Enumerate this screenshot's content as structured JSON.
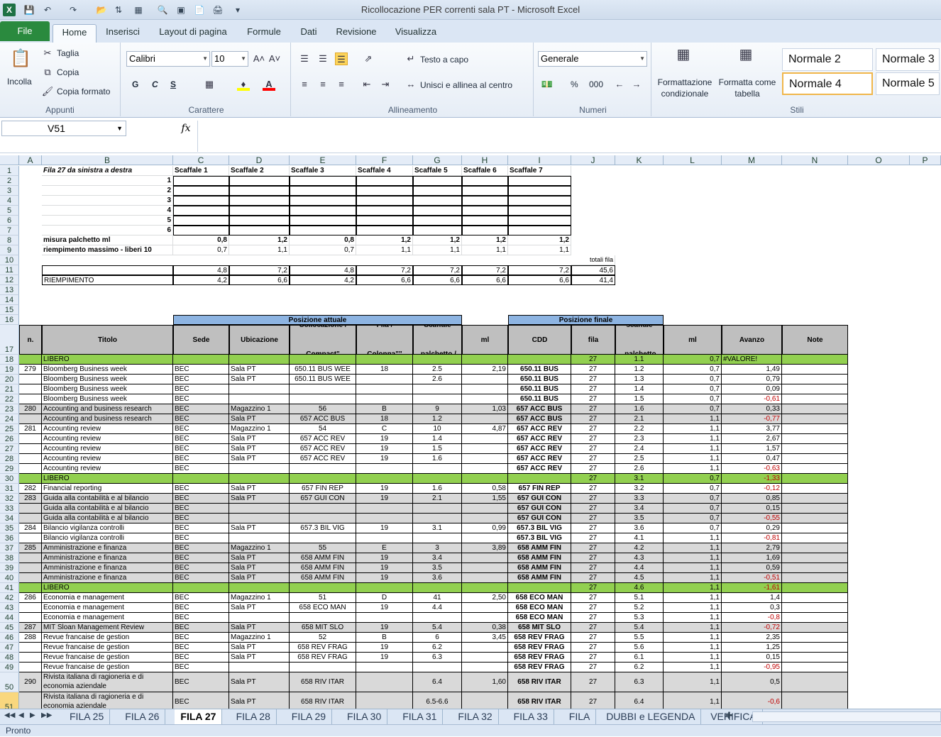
{
  "app": {
    "title": "Ricollocazione PER correnti sala PT  -  Microsoft Excel"
  },
  "ribbon": {
    "tabs": [
      "File",
      "Home",
      "Inserisci",
      "Layout di pagina",
      "Formule",
      "Dati",
      "Revisione",
      "Visualizza"
    ],
    "clipboard": {
      "paste": "Incolla",
      "cut": "Taglia",
      "copy": "Copia",
      "format_painter": "Copia formato",
      "label": "Appunti"
    },
    "font": {
      "name": "Calibri",
      "size": "10",
      "bold": "G",
      "italic": "C",
      "underline": "S",
      "label": "Carattere"
    },
    "alignment": {
      "wrap": "Testo a capo",
      "merge": "Unisci e allinea al centro",
      "label": "Allineamento"
    },
    "number": {
      "format": "Generale",
      "percent": "%",
      "thousands": "000",
      "label": "Numeri"
    },
    "styles": {
      "cond_format": "Formattazione condizionale",
      "as_table": "Formatta come tabella",
      "items": [
        "Normale 2",
        "Normale 3",
        "Normale 4",
        "Normale 5"
      ],
      "label": "Stili"
    }
  },
  "formula_bar": {
    "name_box": "V51",
    "fx": "fx",
    "value": ""
  },
  "sheet": {
    "columns": [
      "A",
      "B",
      "C",
      "D",
      "E",
      "F",
      "G",
      "H",
      "I",
      "J",
      "K",
      "L",
      "M",
      "N",
      "O",
      "P"
    ],
    "top": {
      "title": "Fila 27 da sinistra a destra",
      "shelves": [
        "Scaffale 1",
        "Scaffale 2",
        "Scaffale 3",
        "Scaffale 4",
        "Scaffale 5",
        "Scaffale 6",
        "Scaffale 7"
      ],
      "shelf_rows": [
        "1",
        "2",
        "3",
        "4",
        "5",
        "6"
      ],
      "misura_label": "misura palchetto ml",
      "misura": [
        "0,8",
        "1,2",
        "0,8",
        "1,2",
        "1,2",
        "1,2",
        "1,2"
      ],
      "riemp_label": "riempimento massimo - liberi 10",
      "riemp": [
        "0,7",
        "1,1",
        "0,7",
        "1,1",
        "1,1",
        "1,1",
        "1,1"
      ],
      "totali_label": "totali fila",
      "row11": [
        "4,8",
        "7,2",
        "4,8",
        "7,2",
        "7,2",
        "7,2",
        "7,2",
        "45,6"
      ],
      "riempimento_label": "RIEMPIMENTO",
      "row12": [
        "4,2",
        "6,6",
        "4,2",
        "6,6",
        "6,6",
        "6,6",
        "6,6",
        "41,4"
      ]
    },
    "headers": {
      "pos_attuale": "Posizione attuale",
      "pos_finale": "Posizione finale",
      "cols": [
        "n.",
        "Titolo",
        "Sede",
        "Ubicazione",
        "Collocazione / Compact\"",
        "Fila / Colonna\"\"",
        "Scaffale .palchetto /",
        "ml",
        "CDD",
        "fila",
        "scaffale .palchetto",
        "ml",
        "Avanzo",
        "Note"
      ]
    },
    "data": [
      {
        "r": "18",
        "cls": "g",
        "v": [
          "",
          "LIBERO",
          "",
          "",
          "",
          "",
          "",
          "",
          "",
          "27",
          "1.1",
          "0,7",
          "#VALORE!",
          ""
        ]
      },
      {
        "r": "19",
        "cls": "",
        "v": [
          "279",
          "Bloomberg Business week",
          "BEC",
          "Sala PT",
          "650.11 BUS WEE",
          "18",
          "2.5",
          "2,19",
          "650.11 BUS",
          "27",
          "1.2",
          "0,7",
          "1,49",
          ""
        ]
      },
      {
        "r": "20",
        "cls": "",
        "v": [
          "",
          "Bloomberg Business week",
          "BEC",
          "Sala PT",
          "650.11 BUS WEE",
          "",
          "2.6",
          "",
          "650.11 BUS",
          "27",
          "1.3",
          "0,7",
          "0,79",
          ""
        ]
      },
      {
        "r": "21",
        "cls": "",
        "v": [
          "",
          "Bloomberg Business week",
          "BEC",
          "",
          "",
          "",
          "",
          "",
          "650.11 BUS",
          "27",
          "1.4",
          "0,7",
          "0,09",
          ""
        ]
      },
      {
        "r": "22",
        "cls": "",
        "v": [
          "",
          "Bloomberg Business week",
          "BEC",
          "",
          "",
          "",
          "",
          "",
          "650.11 BUS",
          "27",
          "1.5",
          "0,7",
          "-0,61",
          ""
        ]
      },
      {
        "r": "23",
        "cls": "gy",
        "v": [
          "280",
          "Accounting and business research",
          "BEC",
          "Magazzino 1",
          "56",
          "B",
          "9",
          "1,03",
          "657 ACC BUS",
          "27",
          "1.6",
          "0,7",
          "0,33",
          ""
        ]
      },
      {
        "r": "24",
        "cls": "gy",
        "v": [
          "",
          "Accounting and business research",
          "BEC",
          "Sala PT",
          "657 ACC BUS",
          "18",
          "1.2",
          "",
          "657 ACC BUS",
          "27",
          "2.1",
          "1,1",
          "-0,77",
          ""
        ]
      },
      {
        "r": "25",
        "cls": "",
        "v": [
          "281",
          "Accounting review",
          "BEC",
          "Magazzino 1",
          "54",
          "C",
          "10",
          "4,87",
          "657 ACC REV",
          "27",
          "2.2",
          "1,1",
          "3,77",
          ""
        ]
      },
      {
        "r": "26",
        "cls": "",
        "v": [
          "",
          "Accounting review",
          "BEC",
          "Sala PT",
          "657 ACC REV",
          "19",
          "1.4",
          "",
          "657 ACC REV",
          "27",
          "2.3",
          "1,1",
          "2,67",
          ""
        ]
      },
      {
        "r": "27",
        "cls": "",
        "v": [
          "",
          "Accounting review",
          "BEC",
          "Sala PT",
          "657 ACC REV",
          "19",
          "1.5",
          "",
          "657 ACC REV",
          "27",
          "2.4",
          "1,1",
          "1,57",
          ""
        ]
      },
      {
        "r": "28",
        "cls": "",
        "v": [
          "",
          "Accounting review",
          "BEC",
          "Sala PT",
          "657 ACC REV",
          "19",
          "1.6",
          "",
          "657 ACC REV",
          "27",
          "2.5",
          "1,1",
          "0,47",
          ""
        ]
      },
      {
        "r": "29",
        "cls": "",
        "v": [
          "",
          "Accounting review",
          "BEC",
          "",
          "",
          "",
          "",
          "",
          "657 ACC REV",
          "27",
          "2.6",
          "1,1",
          "-0,63",
          ""
        ]
      },
      {
        "r": "30",
        "cls": "g",
        "v": [
          "",
          "LIBERO",
          "",
          "",
          "",
          "",
          "",
          "",
          "",
          "27",
          "3.1",
          "0,7",
          "-1,33",
          ""
        ]
      },
      {
        "r": "31",
        "cls": "",
        "v": [
          "282",
          "Financial reporting",
          "BEC",
          "Sala PT",
          "657 FIN REP",
          "19",
          "1.6",
          "0,58",
          "657 FIN REP",
          "27",
          "3.2",
          "0,7",
          "-0,12",
          ""
        ]
      },
      {
        "r": "32",
        "cls": "gy",
        "v": [
          "283",
          "Guida alla contabilità e al bilancio",
          "BEC",
          "Sala PT",
          "657 GUI CON",
          "19",
          "2.1",
          "1,55",
          "657 GUI CON",
          "27",
          "3.3",
          "0,7",
          "0,85",
          ""
        ]
      },
      {
        "r": "33",
        "cls": "gy",
        "v": [
          "",
          "Guida alla contabilità e al bilancio",
          "BEC",
          "",
          "",
          "",
          "",
          "",
          "657 GUI CON",
          "27",
          "3.4",
          "0,7",
          "0,15",
          ""
        ]
      },
      {
        "r": "34",
        "cls": "gy",
        "v": [
          "",
          "Guida alla contabilità e al bilancio",
          "BEC",
          "",
          "",
          "",
          "",
          "",
          "657 GUI CON",
          "27",
          "3.5",
          "0,7",
          "-0,55",
          ""
        ]
      },
      {
        "r": "35",
        "cls": "",
        "v": [
          "284",
          "Bilancio vigilanza controlli",
          "BEC",
          "Sala PT",
          "657.3 BIL VIG",
          "19",
          "3.1",
          "0,99",
          "657.3 BIL VIG",
          "27",
          "3.6",
          "0,7",
          "0,29",
          ""
        ]
      },
      {
        "r": "36",
        "cls": "",
        "v": [
          "",
          "Bilancio vigilanza controlli",
          "BEC",
          "",
          "",
          "",
          "",
          "",
          "657.3 BIL VIG",
          "27",
          "4.1",
          "1,1",
          "-0,81",
          ""
        ]
      },
      {
        "r": "37",
        "cls": "gy",
        "v": [
          "285",
          "Amministrazione e finanza",
          "BEC",
          "Magazzino 1",
          "55",
          "E",
          "3",
          "3,89",
          "658 AMM FIN",
          "27",
          "4.2",
          "1,1",
          "2,79",
          ""
        ]
      },
      {
        "r": "38",
        "cls": "gy",
        "v": [
          "",
          "Amministrazione e finanza",
          "BEC",
          "Sala PT",
          "658 AMM FIN",
          "19",
          "3.4",
          "",
          "658 AMM FIN",
          "27",
          "4.3",
          "1,1",
          "1,69",
          ""
        ]
      },
      {
        "r": "39",
        "cls": "gy",
        "v": [
          "",
          "Amministrazione e finanza",
          "BEC",
          "Sala PT",
          "658 AMM FIN",
          "19",
          "3.5",
          "",
          "658 AMM FIN",
          "27",
          "4.4",
          "1,1",
          "0,59",
          ""
        ]
      },
      {
        "r": "40",
        "cls": "gy",
        "v": [
          "",
          "Amministrazione e finanza",
          "BEC",
          "Sala PT",
          "658 AMM FIN",
          "19",
          "3.6",
          "",
          "658 AMM FIN",
          "27",
          "4.5",
          "1,1",
          "-0,51",
          ""
        ]
      },
      {
        "r": "41",
        "cls": "g",
        "v": [
          "",
          "LIBERO",
          "",
          "",
          "",
          "",
          "",
          "",
          "",
          "27",
          "4.6",
          "1,1",
          "-1,61",
          ""
        ]
      },
      {
        "r": "42",
        "cls": "",
        "v": [
          "286",
          "Economia e management",
          "BEC",
          "Magazzino 1",
          "51",
          "D",
          "41",
          "2,50",
          "658 ECO MAN",
          "27",
          "5.1",
          "1,1",
          "1,4",
          ""
        ]
      },
      {
        "r": "43",
        "cls": "",
        "v": [
          "",
          "Economia e management",
          "BEC",
          "Sala PT",
          "658 ECO MAN",
          "19",
          "4.4",
          "",
          "658 ECO MAN",
          "27",
          "5.2",
          "1,1",
          "0,3",
          ""
        ]
      },
      {
        "r": "44",
        "cls": "",
        "v": [
          "",
          "Economia e management",
          "BEC",
          "",
          "",
          "",
          "",
          "",
          "658 ECO MAN",
          "27",
          "5.3",
          "1,1",
          "-0,8",
          ""
        ]
      },
      {
        "r": "45",
        "cls": "gy",
        "v": [
          "287",
          "MIT Sloan Management Review",
          "BEC",
          "Sala PT",
          "658 MIT SLO",
          "19",
          "5.4",
          "0,38",
          "658 MIT SLO",
          "27",
          "5.4",
          "1,1",
          "-0,72",
          ""
        ]
      },
      {
        "r": "46",
        "cls": "",
        "v": [
          "288",
          "Revue francaise de gestion",
          "BEC",
          "Magazzino 1",
          "52",
          "B",
          "6",
          "3,45",
          "658 REV FRAG",
          "27",
          "5.5",
          "1,1",
          "2,35",
          ""
        ]
      },
      {
        "r": "47",
        "cls": "",
        "v": [
          "",
          "Revue francaise de gestion",
          "BEC",
          "Sala PT",
          "658 REV FRAG",
          "19",
          "6.2",
          "",
          "658 REV FRAG",
          "27",
          "5.6",
          "1,1",
          "1,25",
          ""
        ]
      },
      {
        "r": "48",
        "cls": "",
        "v": [
          "",
          "Revue francaise de gestion",
          "BEC",
          "Sala PT",
          "658 REV FRAG",
          "19",
          "6.3",
          "",
          "658 REV FRAG",
          "27",
          "6.1",
          "1,1",
          "0,15",
          ""
        ]
      },
      {
        "r": "49",
        "cls": "",
        "v": [
          "",
          "Revue francaise de gestion",
          "BEC",
          "",
          "",
          "",
          "",
          "",
          "658 REV FRAG",
          "27",
          "6.2",
          "1,1",
          "-0,95",
          ""
        ]
      },
      {
        "r": "50",
        "cls": "gy",
        "v": [
          "290",
          "Rivista italiana di ragioneria e di economia aziendale",
          "BEC",
          "Sala PT",
          "658 RIV ITAR",
          "",
          "6.4",
          "1,60",
          "658 RIV ITAR",
          "27",
          "6.3",
          "1,1",
          "0,5",
          ""
        ]
      },
      {
        "r": "51",
        "cls": "gy",
        "v": [
          "",
          "Rivista italiana di ragioneria e di economia aziendale",
          "BEC",
          "Sala PT",
          "658 RIV ITAR",
          "",
          "6.5-6.6",
          "",
          "658 RIV ITAR",
          "27",
          "6.4",
          "1,1",
          "-0,6",
          ""
        ]
      }
    ]
  },
  "sheet_tabs": [
    "FILA 25",
    "FILA 26",
    "FILA 27",
    "FILA 28",
    "FILA 29",
    "FILA 30",
    "FILA 31",
    "FILA 32",
    "FILA 33",
    "FILA",
    "DUBBI e LEGENDA",
    "VERIFICA"
  ],
  "active_tab": "FILA 27",
  "status": {
    "text": "Pronto"
  }
}
